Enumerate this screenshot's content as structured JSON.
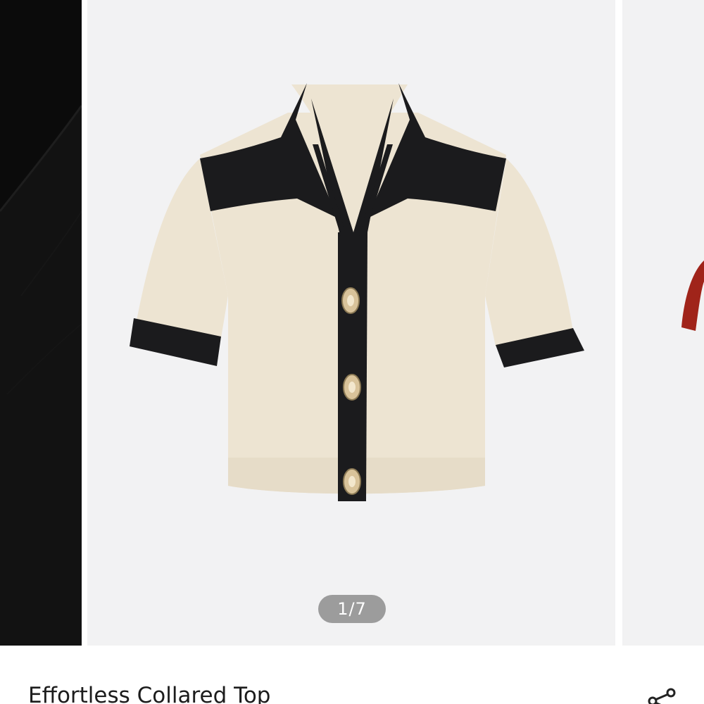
{
  "carousel": {
    "indicator": "1/7",
    "current_index": 1,
    "total": 7
  },
  "product": {
    "title": "Effortless Collared Top"
  },
  "icons": {
    "share": "share-icon"
  },
  "colors": {
    "background": "#ffffff",
    "slide_background": "#f2f2f3",
    "indicator_background": "#9c9c9c",
    "garment_body": "#ede4d2",
    "garment_trim": "#1b1b1d",
    "button_metal": "#d9c39a",
    "next_garment": "#a0241a",
    "prev_fabric": "#0b0b0b",
    "title_text": "#1c1c1c"
  }
}
